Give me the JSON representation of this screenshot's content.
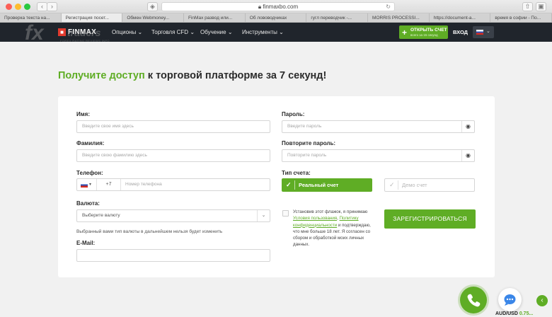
{
  "browser": {
    "url": "finmaxbo.com",
    "tabs": [
      "Проверка текста на...",
      "Регистрация посет...",
      "Обмен Webmoney...",
      "FinMax развод или...",
      "Об лововодчиках",
      "гугл переводчик -...",
      "MORRIS PROCESSI...",
      "https://document-a...",
      "время в софии - По..."
    ],
    "active_tab": 1
  },
  "watermark": {
    "brand": "fx",
    "brand2": "traders",
    "tagline": "FOREX RATING REVIEWS INFO"
  },
  "header": {
    "logo_text": "FINMAX",
    "nav": [
      "Опционы",
      "Торговля CFD",
      "Обучение",
      "Инструменты"
    ],
    "open_account": "ОТКРЫТЬ СЧЕТ",
    "open_account_sub": "всего за 15 секунд",
    "login": "ВХОД"
  },
  "page": {
    "heading_green": "Получите доступ",
    "heading_rest": " к торговой платформе за 7 секунд!"
  },
  "form": {
    "name_label": "Имя:",
    "name_placeholder": "Введите свое имя здесь",
    "surname_label": "Фамилия:",
    "surname_placeholder": "Введите свою фамилию здесь",
    "phone_label": "Телефон:",
    "phone_prefix": "+7",
    "phone_placeholder": "Номер телефона",
    "currency_label": "Валюта:",
    "currency_value": "Выберите валюту",
    "currency_note": "Выбранный вами тип валюты в дальнейшем нельзя будет изменить",
    "email_label": "E-Mail:",
    "password_label": "Пароль:",
    "password_placeholder": "Введите пароль",
    "password2_label": "Повторите пароль:",
    "password2_placeholder": "Повторите пароль",
    "account_type_label": "Тип счета:",
    "account_real": "Реальный счет",
    "account_demo": "Демо счет",
    "agree_1": "Установив этот флажок, я принимаю ",
    "agree_link1": "Условия пользования",
    "agree_2": ", ",
    "agree_link2": "Политику конфиденциальности",
    "agree_3": " и подтверждаю, что мне больше 18 лет. Я согласен со сбором и обработкой моих личных данных.",
    "register_button": "ЗАРЕГИСТРИРОВАТЬСЯ"
  },
  "footer": {
    "ticker_pair": "AUD/USD",
    "ticker_value": "0.75..."
  },
  "colors": {
    "accent": "#5fad25",
    "header_bg": "#20252c"
  }
}
